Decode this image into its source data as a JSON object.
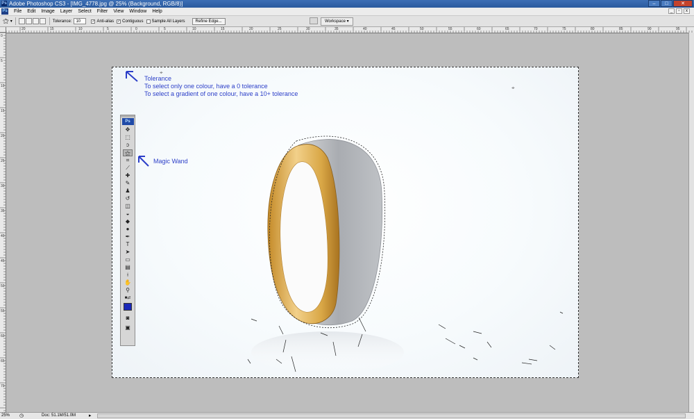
{
  "window": {
    "title": "Adobe Photoshop CS3 - [IMG_4778.jpg @ 25% (Background, RGB/8)]",
    "app_icon": "Ps",
    "controls": [
      "minimize-icon",
      "maximize-icon",
      "close-icon"
    ]
  },
  "menu": {
    "items": [
      "File",
      "Edit",
      "Image",
      "Layer",
      "Select",
      "Filter",
      "View",
      "Window",
      "Help"
    ]
  },
  "options": {
    "tolerance_label": "Tolerance:",
    "tolerance_value": "10",
    "anti_alias_label": "Anti-alias",
    "anti_alias_checked": true,
    "contiguous_label": "Contiguous",
    "contiguous_checked": true,
    "sample_all_label": "Sample All Layers",
    "sample_all_checked": false,
    "refine_edge_label": "Refine Edge...",
    "workspace_label": "Workspace ▾"
  },
  "rulers": {
    "top_marks": [
      "20",
      "15",
      "10",
      "5",
      "0",
      "5",
      "10",
      "15",
      "20",
      "25",
      "30",
      "35",
      "40",
      "45",
      "50",
      "55",
      "60",
      "65",
      "70",
      "75",
      "80",
      "85",
      "90",
      "95"
    ],
    "left_marks": [
      "0",
      "5",
      "10",
      "15",
      "20",
      "25",
      "30",
      "35",
      "40",
      "45",
      "50",
      "55",
      "60",
      "65",
      "70"
    ]
  },
  "annotations": {
    "tolerance_title": "Tolerance",
    "tolerance_line1": "To select only one colour, have a 0 tolerance",
    "tolerance_line2": "To select a gradient of one colour, have a 10+ tolerance",
    "magic_wand": "Magic Wand",
    "color": "#2b3ec8"
  },
  "toolbox": {
    "badge": "Ps",
    "active_tool": "magic-wand-tool",
    "foreground_color": "#1a28b8"
  },
  "status": {
    "zoom": "25%",
    "doc_size": "Doc: 51.1M/51.0M"
  },
  "image": {
    "subject": "ring",
    "colors": {
      "silver": "#b9bcc0",
      "gold": "#d9a746",
      "background": "#ffffff"
    }
  }
}
